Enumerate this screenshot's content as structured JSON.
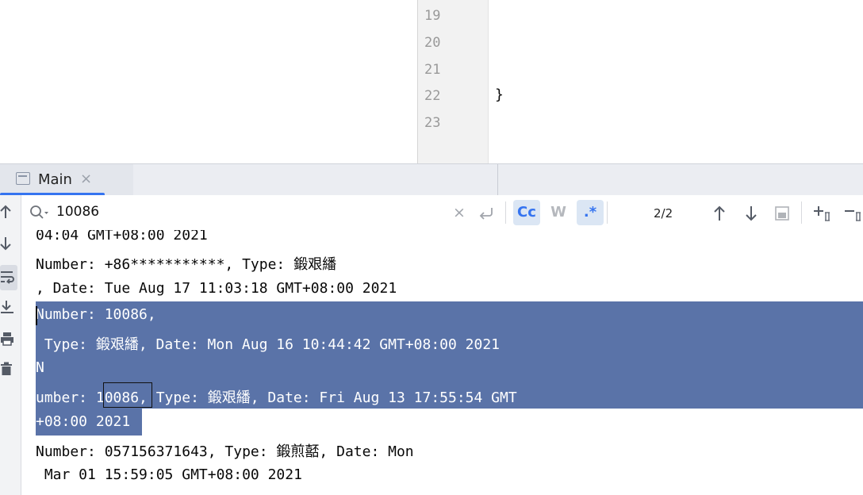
{
  "editor": {
    "line_numbers": [
      "19",
      "20",
      "21",
      "22",
      "23"
    ],
    "code_line_22": "}"
  },
  "tool_window": {
    "tab_label": "Main",
    "tab_close": "×"
  },
  "search": {
    "value": "10086",
    "clear_glyph": "×",
    "match_case_label": "Cc",
    "words_label": "W",
    "regex_label": ".*",
    "counter": "2/2"
  },
  "console": {
    "lines": [
      "04:04 GMT+08:00 2021",
      "Number: +86***********, Type: 鍛艰繙",
      ", Date: Tue Aug 17 11:03:18 GMT+08:00 2021",
      "Number: 10086,",
      " Type: 鍛艰繙, Date: Mon Aug 16 10:44:42 GMT+08:00 2021",
      "N",
      "umber: 10086, Type: 鍛艰繙, Date: Fri Aug 13 17:55:54 GMT",
      "+08:00 2021",
      "Number: 057156371643, Type: 鍛煎嚭, Date: Mon",
      " Mar 01 15:59:05 GMT+08:00 2021"
    ]
  },
  "colors": {
    "selection": "#5a73a8",
    "accent": "#3574f0",
    "toggle_active": "#dbe6f4"
  },
  "icons": [
    "up-arrow-icon",
    "down-arrow-icon",
    "soft-wrap-icon",
    "scroll-to-end-icon",
    "print-icon",
    "trash-icon",
    "search-icon",
    "clear-icon",
    "newline-icon",
    "prev-occurrence-icon",
    "next-occurrence-icon",
    "select-all-occurrences-icon",
    "add-cursor-icon",
    "remove-cursor-icon"
  ]
}
